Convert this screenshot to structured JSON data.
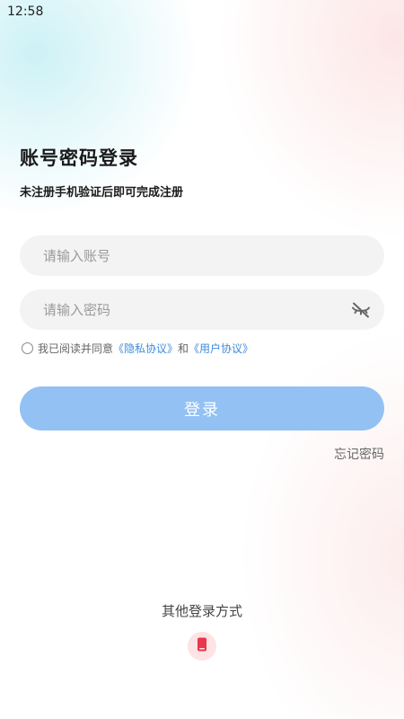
{
  "status_bar": {
    "time": "12:58"
  },
  "login": {
    "title": "账号密码登录",
    "subtitle": "未注册手机验证后即可完成注册",
    "account_placeholder": "请输入账号",
    "password_placeholder": "请输入密码",
    "password_toggle_icon": "eye-off-icon",
    "agreement": {
      "prefix": "我已阅读并同意",
      "privacy_link": "《隐私协议》",
      "conjunction": "和",
      "user_link": "《用户协议》",
      "checked": false
    },
    "login_button": "登录",
    "forgot_password": "忘记密码",
    "other_methods_label": "其他登录方式",
    "phone_login_icon": "phone-icon"
  },
  "colors": {
    "accent": "#93c1f3",
    "link": "#3d8ce0",
    "phone_icon": "#e8374a",
    "phone_icon_bg": "#fde3e3"
  }
}
